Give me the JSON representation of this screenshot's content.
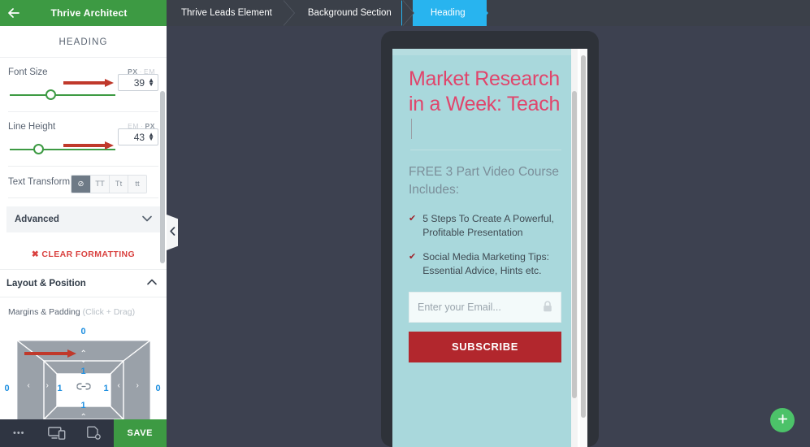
{
  "sidebar": {
    "app_title": "Thrive Architect",
    "back_icon": "arrow-left-icon",
    "element_title": "HEADING",
    "font_size": {
      "label": "Font Size",
      "unit_left": "PX",
      "unit_right": "EM",
      "unit_active": "PX",
      "value": "39"
    },
    "line_height": {
      "label": "Line Height",
      "unit_left": "EM",
      "unit_right": "PX",
      "unit_active": "PX",
      "value": "43"
    },
    "text_transform": {
      "label": "Text Transform",
      "options": [
        "none",
        "TT",
        "Tt",
        "tt"
      ],
      "none_glyph": "⊘",
      "active": "none"
    },
    "advanced": {
      "label": "Advanced",
      "chevron": "chevron-down-icon"
    },
    "clear_formatting": {
      "label": "CLEAR FORMATTING",
      "icon": "✖"
    },
    "layout_position": {
      "label": "Layout & Position",
      "chevron": "chevron-up-icon"
    },
    "margins_padding": {
      "label": "Margins & Padding",
      "hint": "(Click + Drag)",
      "margin_top": "0",
      "margin_right": "0",
      "margin_bottom": "0",
      "margin_left": "0",
      "padding_top": "1",
      "padding_right": "1",
      "padding_bottom": "1",
      "padding_left": "1",
      "link_icon": "link-icon"
    },
    "footer": {
      "more_label": "•••",
      "responsive_icon": "responsive-devices-icon",
      "page_settings_icon": "page-settings-icon",
      "save_label": "SAVE"
    },
    "accent_green": "#3d9a43"
  },
  "breadcrumb": {
    "items": [
      {
        "label": "Thrive Leads Element",
        "active": false
      },
      {
        "label": "Background Section",
        "active": false
      },
      {
        "label": "Heading",
        "active": true
      }
    ],
    "active_color": "#28b4ef"
  },
  "canvas": {
    "collapse_handle_icon": "chevron-left-icon",
    "background_color": "#3d4150",
    "fab": {
      "icon": "plus-icon",
      "color": "#4cc269"
    }
  },
  "preview": {
    "headline": "Market Research in a Week: Teach",
    "headline_color": "#e0456b",
    "subhead": "FREE 3 Part Video Course Includes:",
    "bullets": [
      {
        "check": "✔",
        "text": "5 Steps To Create A Powerful, Profitable Presentation"
      },
      {
        "check": "✔",
        "text": "Social Media Marketing Tips: Essential Advice, Hints etc."
      }
    ],
    "email_placeholder": "Enter your Email...",
    "lock_icon": "lock-icon",
    "subscribe_label": "SUBSCRIBE",
    "page_background": "#a9d8dc",
    "subscribe_color": "#b2272d"
  }
}
